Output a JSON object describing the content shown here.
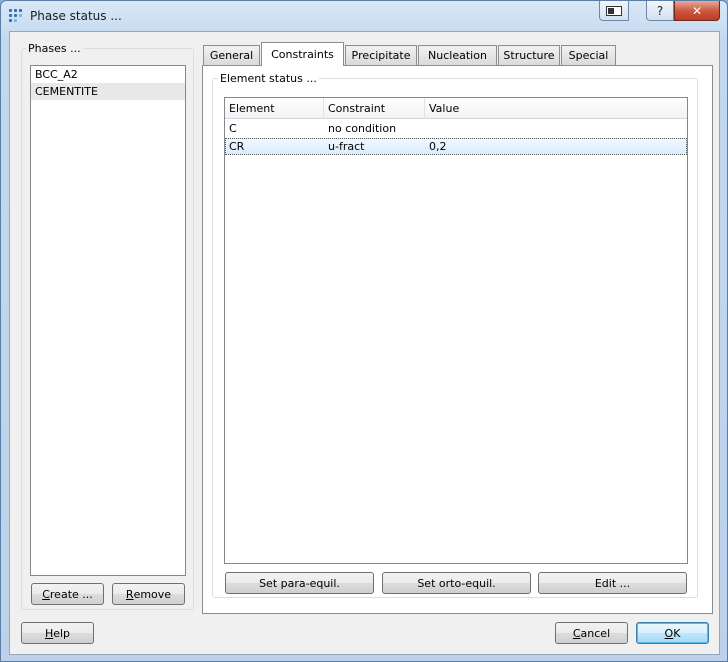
{
  "window": {
    "title": "Phase status ...",
    "caption_help": "?",
    "caption_close": "✕"
  },
  "phases": {
    "group_title": "Phases ...",
    "items": [
      "BCC_A2",
      "CEMENTITE"
    ],
    "selected": "CEMENTITE",
    "create_button": {
      "u": "C",
      "rest": "reate ..."
    },
    "remove_button": {
      "u": "R",
      "rest": "emove"
    }
  },
  "tabs": [
    {
      "u": "G",
      "rest": "eneral"
    },
    {
      "pre": "Co",
      "u": "n",
      "rest": "straints"
    },
    {
      "u": "P",
      "rest": "recipitate"
    },
    {
      "u": "N",
      "rest": "ucleation"
    },
    {
      "pre": "",
      "u": "",
      "rest": "Structure"
    },
    {
      "u": "S",
      "rest": "pecial"
    }
  ],
  "active_tab": "Constraints",
  "element_status": {
    "group_title": "Element status ...",
    "columns": [
      "Element",
      "Constraint",
      "Value"
    ],
    "rows": [
      {
        "element": "C",
        "constraint": "no condition",
        "value": ""
      },
      {
        "element": "CR",
        "constraint": "u-fract",
        "value": "0,2"
      }
    ],
    "selected_row": 1,
    "buttons": {
      "set_para": "Set para-equil.",
      "set_orto": "Set orto-equil.",
      "edit": "Edit ..."
    }
  },
  "footer": {
    "help": {
      "u": "H",
      "rest": "elp"
    },
    "cancel": {
      "u": "C",
      "rest": "ancel"
    },
    "ok": {
      "u": "O",
      "rest": "K"
    }
  },
  "colors": {
    "titlebar": "#c3d8ee",
    "close_button": "#c9553d",
    "selection": "#daecfc",
    "app_icon": "#2c6fb7"
  }
}
